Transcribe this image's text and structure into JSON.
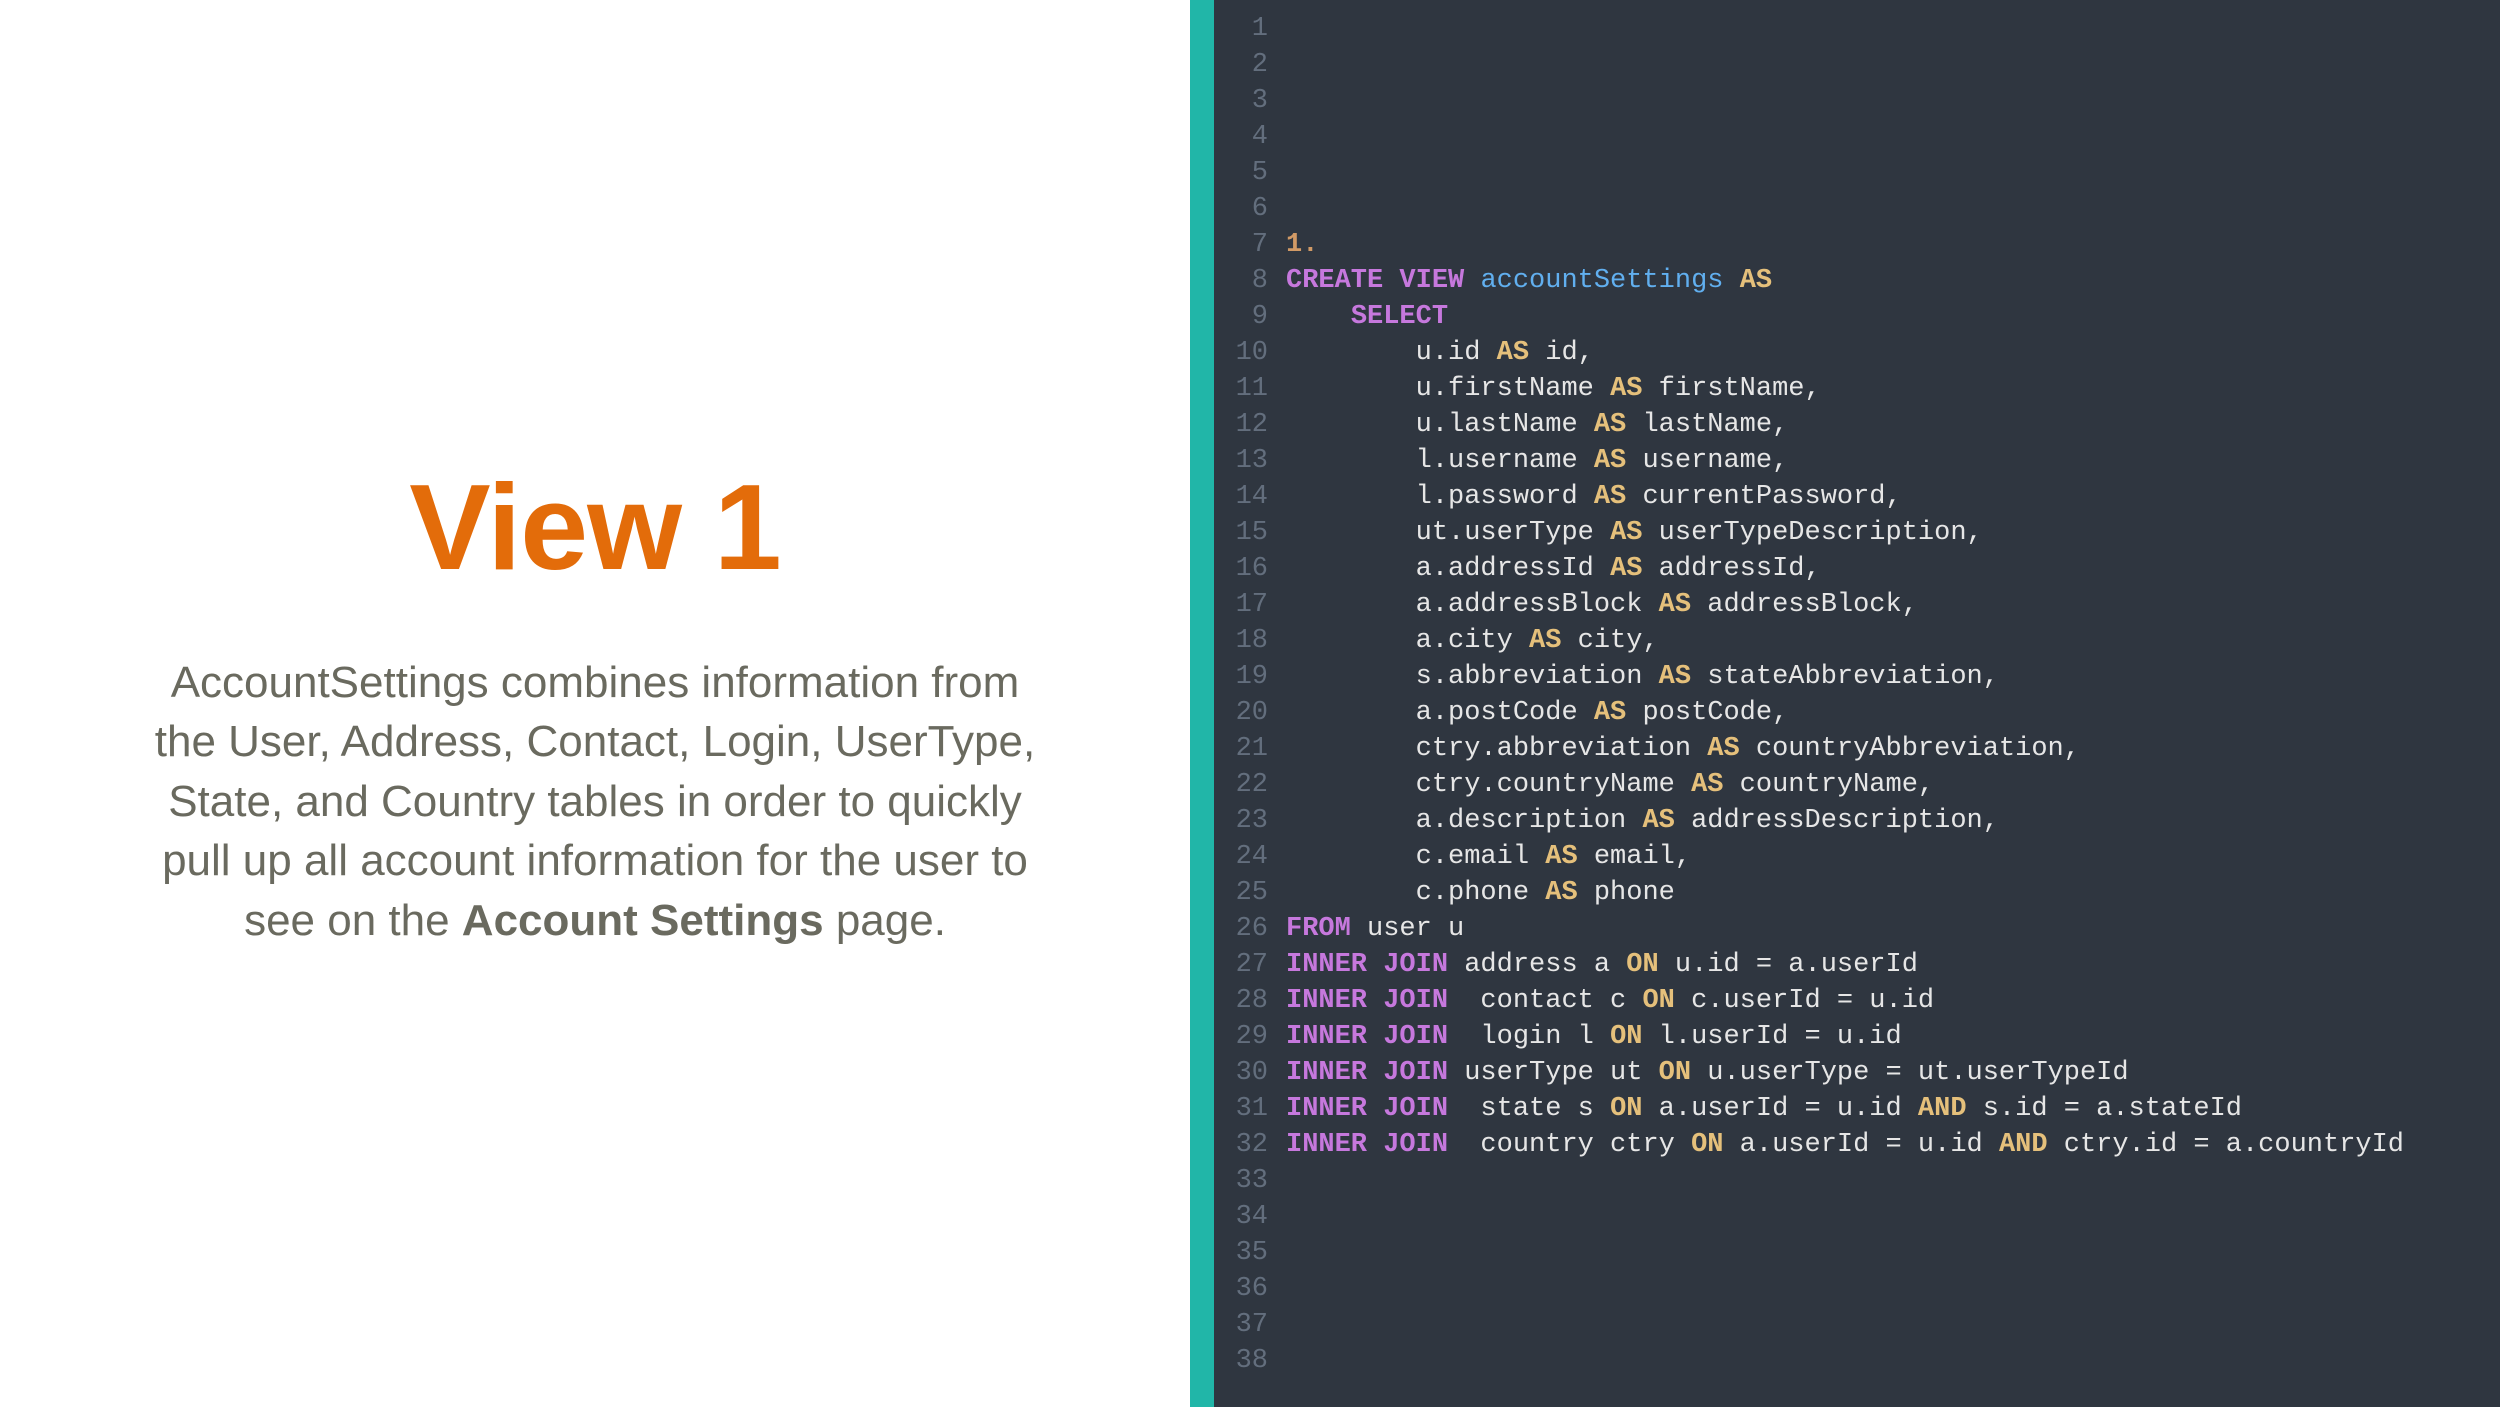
{
  "left": {
    "title": "View 1",
    "desc_pre": "AccountSettings combines information from the User, Address, Contact, Login, UserType, State, and Country tables in order to quickly pull up all account information for the user to see on the ",
    "desc_bold": "Account Settings",
    "desc_post": " page."
  },
  "code": {
    "first_line_num": 1,
    "last_line_num": 38,
    "lines": [
      {
        "n": 1,
        "tokens": []
      },
      {
        "n": 2,
        "tokens": []
      },
      {
        "n": 3,
        "tokens": []
      },
      {
        "n": 4,
        "tokens": []
      },
      {
        "n": 5,
        "tokens": []
      },
      {
        "n": 6,
        "tokens": []
      },
      {
        "n": 7,
        "tokens": [
          {
            "c": "num b",
            "t": "1."
          }
        ]
      },
      {
        "n": 8,
        "tokens": [
          {
            "c": "kw b",
            "t": "CREATE VIEW "
          },
          {
            "c": "id",
            "t": "accountSettings"
          },
          {
            "c": "txt",
            "t": " "
          },
          {
            "c": "ask b",
            "t": "AS"
          }
        ]
      },
      {
        "n": 9,
        "tokens": [
          {
            "c": "txt",
            "t": "    "
          },
          {
            "c": "kw b",
            "t": "SELECT"
          }
        ]
      },
      {
        "n": 10,
        "tokens": [
          {
            "c": "txt",
            "t": "        u.id "
          },
          {
            "c": "ask b",
            "t": "AS"
          },
          {
            "c": "txt",
            "t": " id,"
          }
        ]
      },
      {
        "n": 11,
        "tokens": [
          {
            "c": "txt",
            "t": "        u.firstName "
          },
          {
            "c": "ask b",
            "t": "AS"
          },
          {
            "c": "txt",
            "t": " firstName,"
          }
        ]
      },
      {
        "n": 12,
        "tokens": [
          {
            "c": "txt",
            "t": "        u.lastName "
          },
          {
            "c": "ask b",
            "t": "AS"
          },
          {
            "c": "txt",
            "t": " lastName,"
          }
        ]
      },
      {
        "n": 13,
        "tokens": [
          {
            "c": "txt",
            "t": "        l.username "
          },
          {
            "c": "ask b",
            "t": "AS"
          },
          {
            "c": "txt",
            "t": " username,"
          }
        ]
      },
      {
        "n": 14,
        "tokens": [
          {
            "c": "txt",
            "t": "        l.password "
          },
          {
            "c": "ask b",
            "t": "AS"
          },
          {
            "c": "txt",
            "t": " currentPassword,"
          }
        ]
      },
      {
        "n": 15,
        "tokens": [
          {
            "c": "txt",
            "t": "        ut.userType "
          },
          {
            "c": "ask b",
            "t": "AS"
          },
          {
            "c": "txt",
            "t": " userTypeDescription,"
          }
        ]
      },
      {
        "n": 16,
        "tokens": [
          {
            "c": "txt",
            "t": "        a.addressId "
          },
          {
            "c": "ask b",
            "t": "AS"
          },
          {
            "c": "txt",
            "t": " addressId,"
          }
        ]
      },
      {
        "n": 17,
        "tokens": [
          {
            "c": "txt",
            "t": "        a.addressBlock "
          },
          {
            "c": "ask b",
            "t": "AS"
          },
          {
            "c": "txt",
            "t": " addressBlock,"
          }
        ]
      },
      {
        "n": 18,
        "tokens": [
          {
            "c": "txt",
            "t": "        a.city "
          },
          {
            "c": "ask b",
            "t": "AS"
          },
          {
            "c": "txt",
            "t": " city,"
          }
        ]
      },
      {
        "n": 19,
        "tokens": [
          {
            "c": "txt",
            "t": "        s.abbreviation "
          },
          {
            "c": "ask b",
            "t": "AS"
          },
          {
            "c": "txt",
            "t": " stateAbbreviation,"
          }
        ]
      },
      {
        "n": 20,
        "tokens": [
          {
            "c": "txt",
            "t": "        a.postCode "
          },
          {
            "c": "ask b",
            "t": "AS"
          },
          {
            "c": "txt",
            "t": " postCode,"
          }
        ]
      },
      {
        "n": 21,
        "tokens": [
          {
            "c": "txt",
            "t": "        ctry.abbreviation "
          },
          {
            "c": "ask b",
            "t": "AS"
          },
          {
            "c": "txt",
            "t": " countryAbbreviation,"
          }
        ]
      },
      {
        "n": 22,
        "tokens": [
          {
            "c": "txt",
            "t": "        ctry.countryName "
          },
          {
            "c": "ask b",
            "t": "AS"
          },
          {
            "c": "txt",
            "t": " countryName,"
          }
        ]
      },
      {
        "n": 23,
        "tokens": [
          {
            "c": "txt",
            "t": "        a.description "
          },
          {
            "c": "ask b",
            "t": "AS"
          },
          {
            "c": "txt",
            "t": " addressDescription,"
          }
        ]
      },
      {
        "n": 24,
        "tokens": [
          {
            "c": "txt",
            "t": "        c.email "
          },
          {
            "c": "ask b",
            "t": "AS"
          },
          {
            "c": "txt",
            "t": " email,"
          }
        ]
      },
      {
        "n": 25,
        "tokens": [
          {
            "c": "txt",
            "t": "        c.phone "
          },
          {
            "c": "ask b",
            "t": "AS"
          },
          {
            "c": "txt",
            "t": " phone"
          }
        ]
      },
      {
        "n": 26,
        "tokens": [
          {
            "c": "kw b",
            "t": "FROM"
          },
          {
            "c": "txt",
            "t": " user u"
          }
        ]
      },
      {
        "n": 27,
        "tokens": [
          {
            "c": "kw b",
            "t": "INNER JOIN"
          },
          {
            "c": "txt",
            "t": " address a "
          },
          {
            "c": "ask b",
            "t": "ON"
          },
          {
            "c": "txt",
            "t": " u.id = a.userId"
          }
        ]
      },
      {
        "n": 28,
        "tokens": [
          {
            "c": "kw b",
            "t": "INNER JOIN"
          },
          {
            "c": "txt",
            "t": "  contact c "
          },
          {
            "c": "ask b",
            "t": "ON"
          },
          {
            "c": "txt",
            "t": " c.userId = u.id"
          }
        ]
      },
      {
        "n": 29,
        "tokens": [
          {
            "c": "kw b",
            "t": "INNER JOIN"
          },
          {
            "c": "txt",
            "t": "  login l "
          },
          {
            "c": "ask b",
            "t": "ON"
          },
          {
            "c": "txt",
            "t": " l.userId = u.id"
          }
        ]
      },
      {
        "n": 30,
        "tokens": [
          {
            "c": "kw b",
            "t": "INNER JOIN"
          },
          {
            "c": "txt",
            "t": " userType ut "
          },
          {
            "c": "ask b",
            "t": "ON"
          },
          {
            "c": "txt",
            "t": " u.userType = ut.userTypeId"
          }
        ]
      },
      {
        "n": 31,
        "tokens": [
          {
            "c": "kw b",
            "t": "INNER JOIN"
          },
          {
            "c": "txt",
            "t": "  state s "
          },
          {
            "c": "ask b",
            "t": "ON"
          },
          {
            "c": "txt",
            "t": " a.userId = u.id "
          },
          {
            "c": "ask b",
            "t": "AND"
          },
          {
            "c": "txt",
            "t": " s.id = a.stateId"
          }
        ]
      },
      {
        "n": 32,
        "tokens": [
          {
            "c": "kw b",
            "t": "INNER JOIN"
          },
          {
            "c": "txt",
            "t": "  country ctry "
          },
          {
            "c": "ask b",
            "t": "ON"
          },
          {
            "c": "txt",
            "t": " a.userId = u.id "
          },
          {
            "c": "ask b",
            "t": "AND"
          },
          {
            "c": "txt",
            "t": " ctry.id = a.countryId"
          }
        ]
      },
      {
        "n": 33,
        "tokens": []
      },
      {
        "n": 34,
        "tokens": []
      },
      {
        "n": 35,
        "tokens": []
      },
      {
        "n": 36,
        "tokens": []
      },
      {
        "n": 37,
        "tokens": []
      },
      {
        "n": 38,
        "tokens": []
      }
    ]
  }
}
